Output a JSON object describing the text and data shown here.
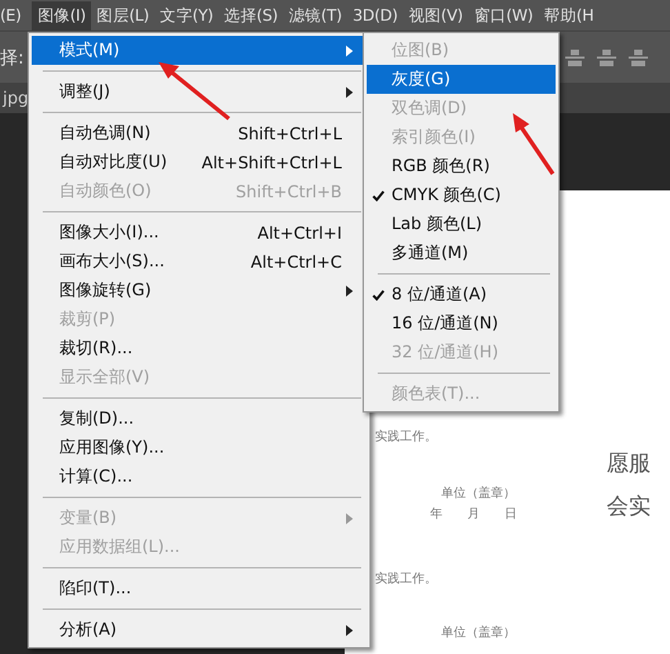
{
  "menu_bar": [
    {
      "label": "(E)",
      "selected": false
    },
    {
      "label": "图像(I)",
      "selected": true
    },
    {
      "label": "图层(L)",
      "selected": false
    },
    {
      "label": "文字(Y)",
      "selected": false
    },
    {
      "label": "选择(S)",
      "selected": false
    },
    {
      "label": "滤镜(T)",
      "selected": false
    },
    {
      "label": "3D(D)",
      "selected": false
    },
    {
      "label": "视图(V)",
      "selected": false
    },
    {
      "label": "窗口(W)",
      "selected": false
    },
    {
      "label": "帮助(H",
      "selected": false
    }
  ],
  "options_bar": {
    "label": "择:"
  },
  "document_tab": {
    "label": "jpg"
  },
  "image_menu": [
    {
      "kind": "item",
      "label": "模式(M)",
      "selected": true,
      "disabled": false,
      "submenu": true
    },
    {
      "kind": "separator"
    },
    {
      "kind": "item",
      "label": "调整(J)",
      "selected": false,
      "disabled": false,
      "submenu": true
    },
    {
      "kind": "separator"
    },
    {
      "kind": "item",
      "label": "自动色调(N)",
      "shortcut": "Shift+Ctrl+L",
      "selected": false,
      "disabled": false,
      "submenu": false
    },
    {
      "kind": "item",
      "label": "自动对比度(U)",
      "shortcut": "Alt+Shift+Ctrl+L",
      "selected": false,
      "disabled": false,
      "submenu": false
    },
    {
      "kind": "item",
      "label": "自动颜色(O)",
      "shortcut": "Shift+Ctrl+B",
      "selected": false,
      "disabled": true,
      "submenu": false
    },
    {
      "kind": "separator"
    },
    {
      "kind": "item",
      "label": "图像大小(I)...",
      "shortcut": "Alt+Ctrl+I",
      "selected": false,
      "disabled": false,
      "submenu": false
    },
    {
      "kind": "item",
      "label": "画布大小(S)...",
      "shortcut": "Alt+Ctrl+C",
      "selected": false,
      "disabled": false,
      "submenu": false
    },
    {
      "kind": "item",
      "label": "图像旋转(G)",
      "selected": false,
      "disabled": false,
      "submenu": true
    },
    {
      "kind": "item",
      "label": "裁剪(P)",
      "selected": false,
      "disabled": true,
      "submenu": false
    },
    {
      "kind": "item",
      "label": "裁切(R)...",
      "selected": false,
      "disabled": false,
      "submenu": false
    },
    {
      "kind": "item",
      "label": "显示全部(V)",
      "selected": false,
      "disabled": true,
      "submenu": false
    },
    {
      "kind": "separator"
    },
    {
      "kind": "item",
      "label": "复制(D)...",
      "selected": false,
      "disabled": false,
      "submenu": false
    },
    {
      "kind": "item",
      "label": "应用图像(Y)...",
      "selected": false,
      "disabled": false,
      "submenu": false
    },
    {
      "kind": "item",
      "label": "计算(C)...",
      "selected": false,
      "disabled": false,
      "submenu": false
    },
    {
      "kind": "separator"
    },
    {
      "kind": "item",
      "label": "变量(B)",
      "selected": false,
      "disabled": true,
      "submenu": true
    },
    {
      "kind": "item",
      "label": "应用数据组(L)...",
      "selected": false,
      "disabled": true,
      "submenu": false
    },
    {
      "kind": "separator"
    },
    {
      "kind": "item",
      "label": "陷印(T)...",
      "selected": false,
      "disabled": false,
      "submenu": false
    },
    {
      "kind": "separator"
    },
    {
      "kind": "item",
      "label": "分析(A)",
      "selected": false,
      "disabled": false,
      "submenu": true
    }
  ],
  "mode_submenu": [
    {
      "kind": "item",
      "label": "位图(B)",
      "selected": false,
      "disabled": true,
      "checked": false
    },
    {
      "kind": "item",
      "label": "灰度(G)",
      "selected": true,
      "disabled": false,
      "checked": false
    },
    {
      "kind": "item",
      "label": "双色调(D)",
      "selected": false,
      "disabled": true,
      "checked": false
    },
    {
      "kind": "item",
      "label": "索引颜色(I)",
      "selected": false,
      "disabled": true,
      "checked": false
    },
    {
      "kind": "item",
      "label": "RGB 颜色(R)",
      "selected": false,
      "disabled": false,
      "checked": false
    },
    {
      "kind": "item",
      "label": "CMYK 颜色(C)",
      "selected": false,
      "disabled": false,
      "checked": true
    },
    {
      "kind": "item",
      "label": "Lab 颜色(L)",
      "selected": false,
      "disabled": false,
      "checked": false
    },
    {
      "kind": "item",
      "label": "多通道(M)",
      "selected": false,
      "disabled": false,
      "checked": false
    },
    {
      "kind": "separator"
    },
    {
      "kind": "item",
      "label": "8 位/通道(A)",
      "selected": false,
      "disabled": false,
      "checked": true
    },
    {
      "kind": "item",
      "label": "16 位/通道(N)",
      "selected": false,
      "disabled": false,
      "checked": false
    },
    {
      "kind": "item",
      "label": "32 位/通道(H)",
      "selected": false,
      "disabled": true,
      "checked": false
    },
    {
      "kind": "separator"
    },
    {
      "kind": "item",
      "label": "颜色表(T)...",
      "selected": false,
      "disabled": true,
      "checked": false
    }
  ],
  "document": {
    "left_column": [
      "实践工作。",
      "单位（盖章）",
      "年　　月　　日",
      "实践工作。",
      "单位（盖章）"
    ],
    "right_column": [
      "愿服",
      "会实"
    ]
  }
}
